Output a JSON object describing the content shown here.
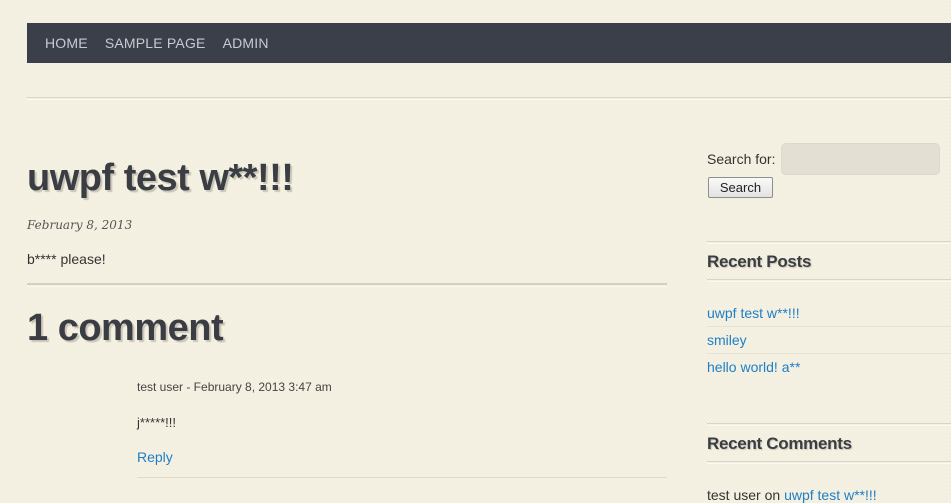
{
  "nav": {
    "items": [
      {
        "label": "HOME"
      },
      {
        "label": "SAMPLE PAGE"
      },
      {
        "label": "ADMIN"
      }
    ]
  },
  "post": {
    "title": "uwpf test w**!!!",
    "date": "February 8, 2013",
    "body": "b**** please!"
  },
  "comments": {
    "heading": "1 comment",
    "items": [
      {
        "meta": "test user - February 8, 2013 3:47 am",
        "text": "j*****!!!",
        "reply_label": "Reply"
      }
    ]
  },
  "sidebar": {
    "search": {
      "label": "Search for:",
      "value": "",
      "button_label": "Search"
    },
    "recent_posts": {
      "title": "Recent Posts",
      "items": [
        {
          "label": "uwpf test w**!!!"
        },
        {
          "label": "smiley"
        },
        {
          "label": "hello world! a**"
        }
      ]
    },
    "recent_comments": {
      "title": "Recent Comments",
      "items": [
        {
          "author": "test user",
          "connector": "on",
          "post": "uwpf test w**!!!"
        }
      ]
    }
  },
  "colors": {
    "nav_bg": "#3b3f4a",
    "link": "#1e7ec8",
    "page_bg": "#f6f2e3"
  }
}
